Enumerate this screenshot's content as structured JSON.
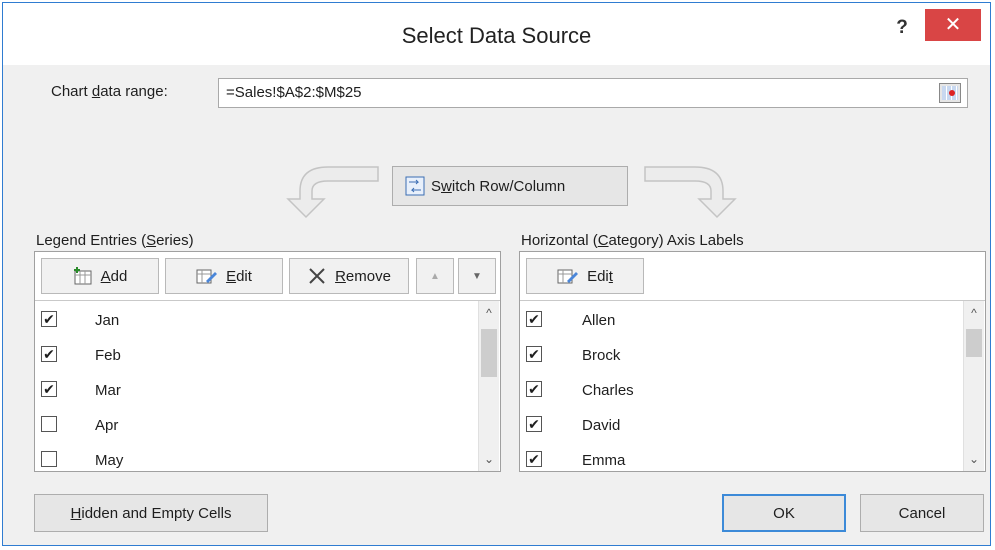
{
  "dialog": {
    "title": "Select Data Source",
    "help_label": "?",
    "close_label": "✕"
  },
  "range": {
    "label_pre": "Chart ",
    "label_accel": "d",
    "label_post": "ata range:",
    "value": "=Sales!$A$2:$M$25"
  },
  "switch": {
    "label_pre": "S",
    "label_accel": "w",
    "label_post": "itch Row/Column"
  },
  "legend": {
    "heading_pre": "Legend Entries (",
    "heading_accel": "S",
    "heading_post": "eries)",
    "toolbar": {
      "add_accel": "A",
      "add_rest": "dd",
      "edit_accel": "E",
      "edit_rest": "dit",
      "remove_accel": "R",
      "remove_rest": "emove",
      "up_glyph": "▲",
      "down_glyph": "▼"
    },
    "items": [
      {
        "label": "Jan",
        "checked": true
      },
      {
        "label": "Feb",
        "checked": true
      },
      {
        "label": "Mar",
        "checked": true
      },
      {
        "label": "Apr",
        "checked": false
      },
      {
        "label": "May",
        "checked": false
      }
    ]
  },
  "axis": {
    "heading_pre": "Horizontal (",
    "heading_accel": "C",
    "heading_post": "ategory) Axis Labels",
    "toolbar": {
      "edit_pre": "Edi",
      "edit_accel": "t"
    },
    "items": [
      {
        "label": "Allen",
        "checked": true
      },
      {
        "label": "Brock",
        "checked": true
      },
      {
        "label": "Charles",
        "checked": true
      },
      {
        "label": "David",
        "checked": true
      },
      {
        "label": "Emma",
        "checked": true
      }
    ]
  },
  "footer": {
    "hidden_accel": "H",
    "hidden_rest": "idden and Empty Cells",
    "ok_label": "OK",
    "cancel_label": "Cancel"
  },
  "check_glyph": "✔",
  "scroll_up_glyph": "^",
  "scroll_down_glyph": "⌄"
}
